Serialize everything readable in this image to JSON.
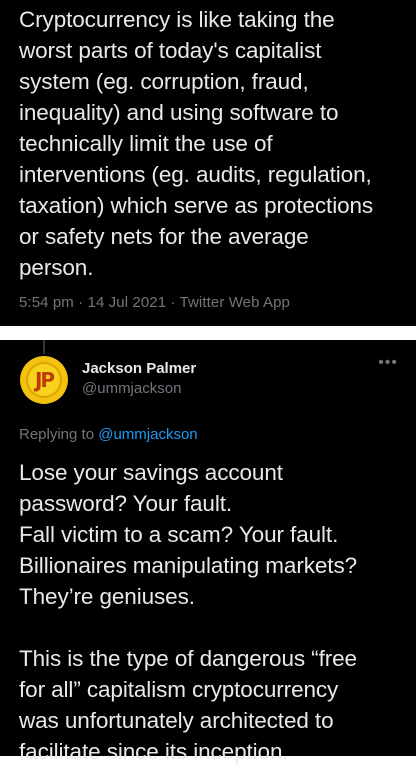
{
  "top_tweet": {
    "text": "Cryptocurrency is like taking the\nworst parts of today's capitalist\nsystem (eg. corruption, fraud,\ninequality) and using software to\ntechnically limit the use of\ninterventions (eg. audits, regulation,\ntaxation) which serve as protections\nor safety nets for the average\nperson.",
    "meta": "5:54 pm · 14 Jul 2021 · Twitter Web App"
  },
  "reply_tweet": {
    "avatar_text": "JP",
    "name": "Jackson Palmer",
    "handle": "@ummjackson",
    "more_icon": "•••",
    "replying_to_label": "Replying to ",
    "replying_to_handle": "@ummjackson",
    "text": "Lose your savings account\npassword? Your fault.\nFall victim to a scam? Your fault.\nBillionaires manipulating markets?\nThey’re geniuses.\n\nThis is the type of dangerous “free\nfor all” capitalism cryptocurrency\nwas unfortunately architected to\nfacilitate since its inception."
  },
  "colors": {
    "background": "#000000",
    "text": "#e7e9ea",
    "muted": "#71767b",
    "link": "#1d9bf0",
    "avatar": "#f2c20f"
  }
}
